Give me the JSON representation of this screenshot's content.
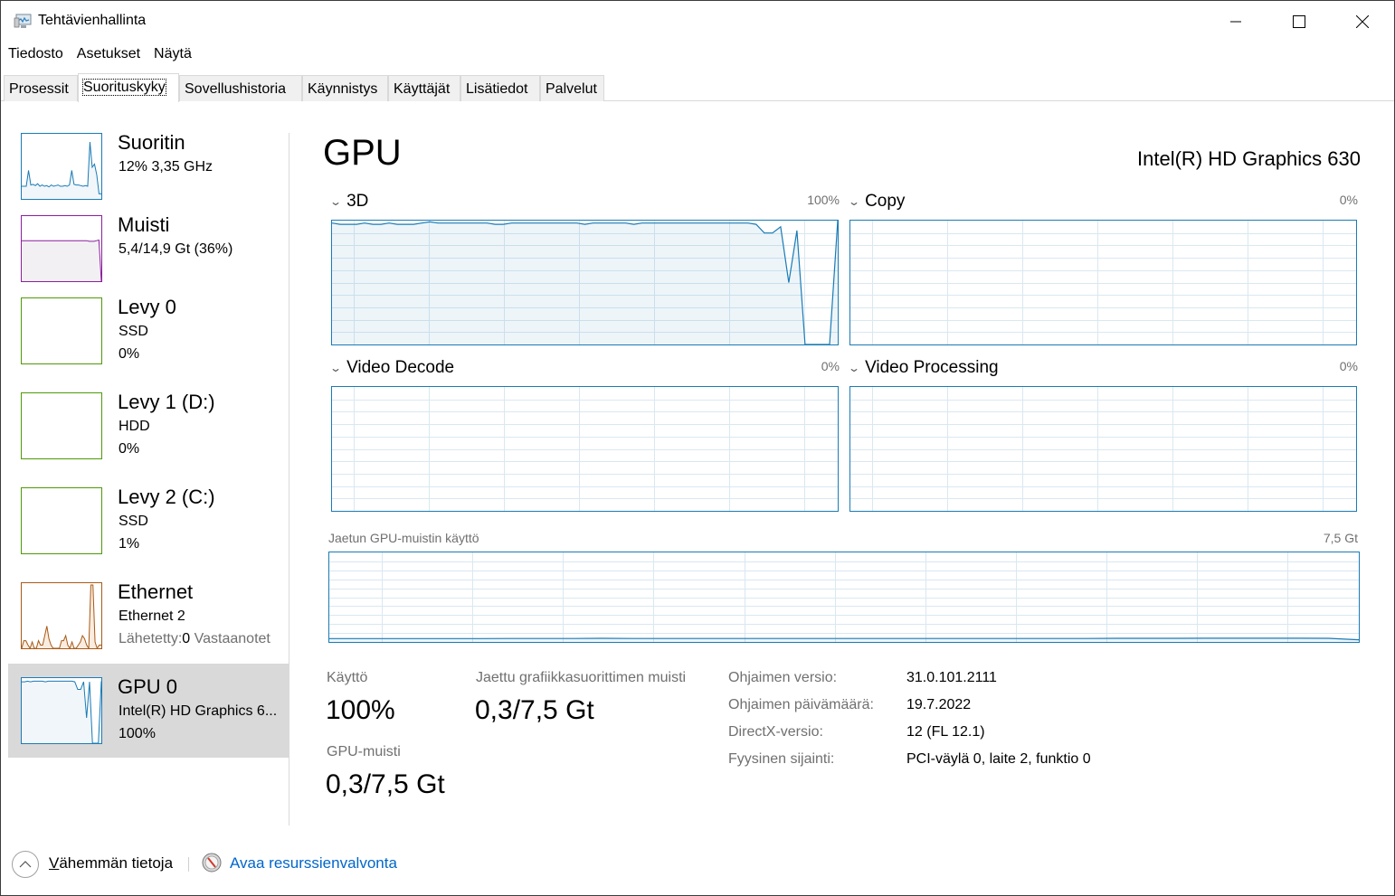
{
  "window": {
    "title": "Tehtävienhallinta",
    "controls": {
      "minimize": "minimize",
      "maximize": "maximize",
      "close": "close"
    }
  },
  "menu": [
    "Tiedosto",
    "Asetukset",
    "Näytä"
  ],
  "tabs": [
    {
      "label": "Prosessit",
      "active": false
    },
    {
      "label": "Suorituskyky",
      "active": true
    },
    {
      "label": "Sovellushistoria",
      "active": false
    },
    {
      "label": "Käynnistys",
      "active": false
    },
    {
      "label": "Käyttäjät",
      "active": false
    },
    {
      "label": "Lisätiedot",
      "active": false
    },
    {
      "label": "Palvelut",
      "active": false
    }
  ],
  "sidebar": {
    "items": [
      {
        "title": "Suoritin",
        "sub1": "12%  3,35 GHz",
        "sub2": "",
        "color": "#1a7bb5",
        "fill": "#f1f6fa",
        "selected": false,
        "series": [
          20,
          20,
          20,
          45,
          22,
          23,
          21,
          24,
          20,
          22,
          20,
          21,
          19,
          22,
          20,
          21,
          22,
          20,
          20,
          21,
          20,
          22,
          45,
          23,
          22,
          22,
          21,
          20,
          21,
          20,
          90,
          50,
          55,
          38,
          8,
          8
        ]
      },
      {
        "title": "Muisti",
        "sub1": "5,4/14,9 Gt (36%)",
        "sub2": "",
        "color": "#8b1f9c",
        "fill": "#f3f0f4",
        "selected": false,
        "series": [
          64,
          64,
          64,
          64,
          64,
          64,
          64,
          64,
          64,
          64,
          64,
          64,
          64,
          64,
          64,
          64,
          64,
          64,
          64,
          64,
          64,
          64,
          64,
          64,
          64,
          64,
          64,
          64,
          63,
          63,
          63,
          64,
          65,
          0
        ]
      },
      {
        "title": "Levy 0",
        "sub1": "SSD",
        "sub2": "0%",
        "color": "#4e9a06",
        "fill": "#ffffff",
        "selected": false,
        "series": []
      },
      {
        "title": "Levy 1 (D:)",
        "sub1": "HDD",
        "sub2": "0%",
        "color": "#4e9a06",
        "fill": "#ffffff",
        "selected": false,
        "series": []
      },
      {
        "title": "Levy 2 (C:)",
        "sub1": "SSD",
        "sub2": "1%",
        "color": "#4e9a06",
        "fill": "#ffffff",
        "selected": false,
        "series": []
      },
      {
        "title": "Ethernet",
        "sub1": "Ethernet 2",
        "sub2_label": "Lähetetty:",
        "sub2_value": "0",
        "sub2_extra": "Vastaanotet",
        "color": "#a75a17",
        "fill": "#fbece0",
        "selected": false,
        "series": [
          0,
          12,
          12,
          5,
          0,
          10,
          0,
          0,
          12,
          5,
          5,
          20,
          35,
          15,
          5,
          0,
          0,
          0,
          0,
          12,
          12,
          20,
          5,
          0,
          10,
          0,
          0,
          5,
          10,
          20,
          15,
          5,
          0,
          100,
          100,
          10,
          0,
          5,
          5
        ]
      },
      {
        "title": "GPU 0",
        "sub1": "Intel(R) HD Graphics 6...",
        "sub2": "100%",
        "color": "#1a7bb5",
        "fill": "#f1f6fa",
        "selected": true,
        "series": [
          97,
          97,
          98,
          97,
          98,
          98,
          98,
          98,
          97,
          98,
          98,
          98,
          98,
          98,
          98,
          98,
          98,
          98,
          97,
          85,
          85,
          97,
          40,
          97,
          0,
          0,
          0,
          98
        ]
      }
    ]
  },
  "main": {
    "title": "GPU",
    "device": "Intel(R) HD Graphics 630",
    "engines": [
      {
        "label": "3D",
        "max": "100%"
      },
      {
        "label": "Copy",
        "max": "0%"
      },
      {
        "label": "Video Decode",
        "max": "0%"
      },
      {
        "label": "Video Processing",
        "max": "0%"
      }
    ],
    "shared_memory": {
      "label": "Jaetun GPU-muistin käyttö",
      "max": "7,5 Gt"
    },
    "stats": {
      "usage_label": "Käyttö",
      "usage_value": "100%",
      "shared_label": "Jaettu grafiikkasuorittimen muisti",
      "shared_value": "0,3/7,5 Gt",
      "gpu_mem_label": "GPU-muisti",
      "gpu_mem_value": "0,3/7,5 Gt"
    },
    "properties": [
      {
        "label": "Ohjaimen versio:",
        "value": "31.0.101.2111"
      },
      {
        "label": "Ohjaimen päivämäärä:",
        "value": "19.7.2022"
      },
      {
        "label": "DirectX-versio:",
        "value": "12 (FL 12.1)"
      },
      {
        "label": "Fyysinen sijainti:",
        "value": "PCI-väylä 0, laite 2, funktio 0"
      }
    ]
  },
  "footer": {
    "fewer_details": "Vähemmän tietoja",
    "open_resmon": "Avaa resurssienvalvonta"
  },
  "chart_data": [
    {
      "type": "line",
      "title": "3D",
      "ylim": [
        0,
        100
      ],
      "ylabel": "%",
      "y_max_label": "100%",
      "grid": true,
      "values": [
        98,
        97,
        97,
        97,
        98,
        97,
        97,
        98,
        97,
        97,
        97,
        98,
        99,
        98,
        98,
        98,
        98,
        98,
        98,
        98,
        97,
        97,
        98,
        98,
        98,
        98,
        98,
        98,
        98,
        98,
        98,
        97,
        98,
        98,
        98,
        98,
        98,
        97,
        98,
        98,
        98,
        98,
        98,
        98,
        98,
        98,
        98,
        98,
        98,
        98,
        98,
        98,
        97,
        90,
        90,
        95,
        50,
        92,
        0,
        0,
        0,
        0,
        100
      ]
    },
    {
      "type": "line",
      "title": "Copy",
      "ylim": [
        0,
        100
      ],
      "y_max_label": "0%",
      "grid": true,
      "values": []
    },
    {
      "type": "line",
      "title": "Video Decode",
      "ylim": [
        0,
        100
      ],
      "y_max_label": "0%",
      "grid": true,
      "values": []
    },
    {
      "type": "line",
      "title": "Video Processing",
      "ylim": [
        0,
        100
      ],
      "y_max_label": "0%",
      "grid": true,
      "values": []
    },
    {
      "type": "area",
      "title": "Jaetun GPU-muistin käyttö",
      "ylim": [
        0,
        7.5
      ],
      "y_max_label": "7,5 Gt",
      "grid": true,
      "values": [
        0.28,
        0.28,
        0.28,
        0.28,
        0.28,
        0.28,
        0.29,
        0.29,
        0.29,
        0.3,
        0.29,
        0.29,
        0.29,
        0.29,
        0.29,
        0.29,
        0.29,
        0.29,
        0.29,
        0.29,
        0.29,
        0.29,
        0.29,
        0.29,
        0.29,
        0.29,
        0.3,
        0.3,
        0.3,
        0.31,
        0.31,
        0.31,
        0.31,
        0.3,
        0.18
      ]
    }
  ]
}
